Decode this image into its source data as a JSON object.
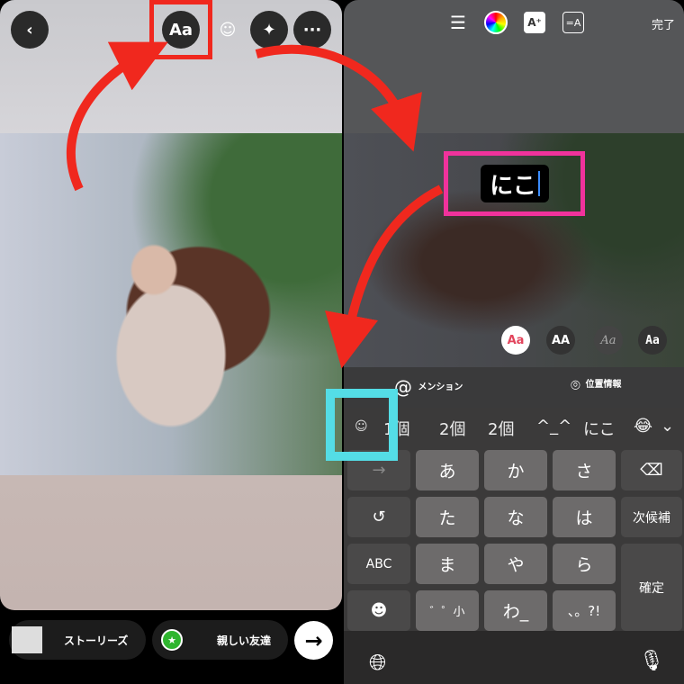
{
  "left_panel": {
    "back_icon": "chevron-left-icon",
    "toolbar": {
      "text_button": "Aa",
      "sticker_icon": "sticker-icon",
      "effects_icon": "sparkles-icon",
      "more_icon": "ellipsis-icon"
    },
    "share": {
      "stories_label": "ストーリーズ",
      "close_friends_label": "親しい友達",
      "next_icon": "arrow-right-icon"
    }
  },
  "right_panel": {
    "toolbar": {
      "align_icon": "align-center-icon",
      "color_icon": "color-wheel-icon",
      "effect_icon": "text-effect-icon",
      "anim_icon": "text-animation-icon",
      "done_label": "完了"
    },
    "text_input": "にこ",
    "font_styles": [
      "Aa",
      "AA",
      "Aa",
      "Aa"
    ],
    "mention_label": "メンション",
    "location_label": "位置情報",
    "candidates": [
      "1個",
      "2個",
      "2個",
      "^_^",
      "にこ"
    ],
    "keys": {
      "row1": [
        "→",
        "あ",
        "か",
        "さ",
        "⌫"
      ],
      "row2": [
        "↺",
        "た",
        "な",
        "は",
        "次候補"
      ],
      "row3": [
        "ABC",
        "ま",
        "や",
        "ら"
      ],
      "row4": [
        "☻",
        "゛゜小",
        "わ_",
        "、。?!"
      ],
      "confirm": "確定"
    }
  },
  "annotations": {
    "red": "#f0281e",
    "pink": "#f0329c",
    "cyan": "#54dde6"
  }
}
